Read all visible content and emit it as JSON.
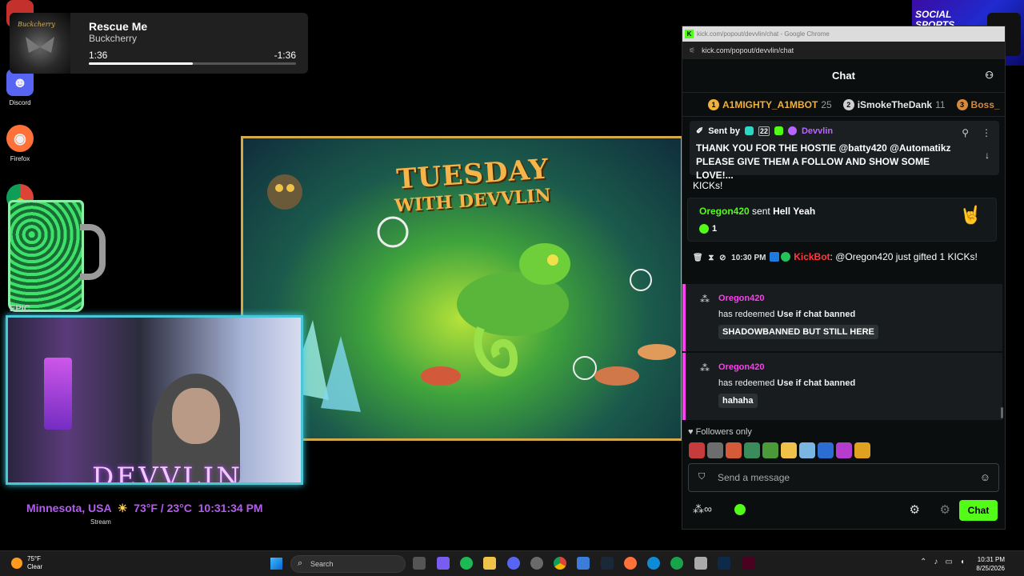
{
  "desktop": {
    "icons": [
      {
        "label": "Discord",
        "glyph": "☻",
        "color": "#5865f2"
      },
      {
        "label": "Firefox",
        "glyph": "◉",
        "color": "#ff7139"
      }
    ],
    "epic_label": "EPIC",
    "stream_label": "Stream"
  },
  "media": {
    "album_band": "Buckcherry",
    "title": "Rescue Me",
    "artist": "Buckcherry",
    "elapsed": "1:36",
    "remaining": "-1:36",
    "progress": 0.5
  },
  "artwork": {
    "line1": "TUESDAY",
    "line2": "WITH DEVVLIN"
  },
  "webcam": {
    "overlay_name": "DEVVLIN"
  },
  "weather_overlay": {
    "location": "Minnesota, USA",
    "temp": "73°F / 23°C",
    "time": "10:31:34 PM"
  },
  "browser": {
    "title": "kick.com/popout/devvlin/chat - Google Chrome",
    "url": "kick.com/popout/devvlin/chat"
  },
  "chat": {
    "header": "Chat",
    "leaderboard": [
      {
        "rank": "1",
        "name": "A1MIGHTY_A1MBOT",
        "count": "25",
        "color": "#f0b13a"
      },
      {
        "rank": "2",
        "name": "iSmokeTheDank",
        "count": "11",
        "color": "#d0d0d0"
      },
      {
        "rank": "3",
        "name": "Boss_",
        "count": "",
        "color": "#d48a3a"
      }
    ],
    "pinned": {
      "sent_by_label": "Sent by",
      "badge_count": "22",
      "author": "Devvlin",
      "message": "THANK YOU FOR THE HOSTIE @batty420 @Automatikz PLEASE GIVE THEM A FOLLOW AND SHOW SOME LOVE!..."
    },
    "kicks_tail": "KICKs!",
    "gift": {
      "user": "Oregon420",
      "verb": "sent",
      "item": "Hell Yeah",
      "count": "1"
    },
    "bot_message": {
      "time": "10:30 PM",
      "author": "KickBot",
      "text": "@Oregon420 just gifted 1 KICKs!"
    },
    "redeems": [
      {
        "user": "Oregon420",
        "prefix": "has redeemed",
        "reward": "Use if chat banned",
        "input": "SHADOWBANNED BUT STILL HERE"
      },
      {
        "user": "Oregon420",
        "prefix": "has redeemed",
        "reward": "Use if chat banned",
        "input": "hahaha"
      }
    ],
    "followers_only": "Followers only",
    "emote_colors": [
      "#c63b3b",
      "#6d6d6d",
      "#d45a3a",
      "#3a8d5a",
      "#4b9a3a",
      "#f0c24a",
      "#7ab6e0",
      "#2b6dd0",
      "#b43dd0",
      "#e0a020"
    ],
    "input_placeholder": "Send a message",
    "send_label": "Chat"
  },
  "ad": {
    "text": "SOCIAL SPORTS GAMING"
  },
  "taskbar": {
    "weather_temp": "75°F",
    "weather_cond": "Clear",
    "search_label": "Search",
    "time": "10:31 PM",
    "date": "8/25/2026",
    "app_colors": [
      "#2d7be0",
      "#7a5cf0",
      "#1db954",
      "#f0c24a",
      "#5865f2",
      "#6a6a6a",
      "#f4b400",
      "#555",
      "#1b6ac9",
      "#ff7139",
      "#0f8bd6",
      "#18a34a",
      "#7d2ea3",
      "#2ea3f2",
      "#ff3366"
    ]
  }
}
